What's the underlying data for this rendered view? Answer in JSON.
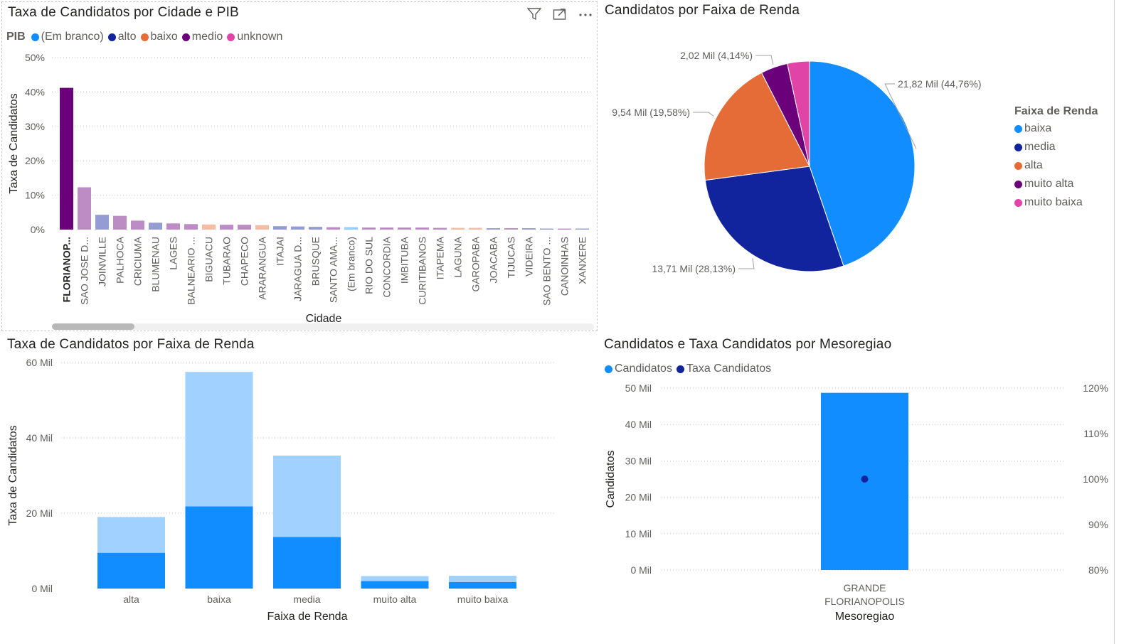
{
  "colors": {
    "blank": "#118dff",
    "alto": "#12239e",
    "baixo": "#e66c37",
    "medio": "#6b007b",
    "unknown": "#e044a7"
  },
  "visual1": {
    "title": "Taxa de Candidatos por Cidade e PIB",
    "icons": [
      "filter-icon",
      "focus-mode-icon",
      "more-options-icon"
    ]
  },
  "visual2": {
    "title": "Candidatos por Faixa de Renda"
  },
  "visual3": {
    "title": "Taxa de Candidatos por Faixa de Renda"
  },
  "visual4": {
    "title": "Candidatos e Taxa Candidatos por Mesoregiao"
  },
  "chart_data": [
    {
      "type": "bar",
      "title": "Taxa de Candidatos por Cidade e PIB",
      "xlabel": "Cidade",
      "ylabel": "Taxa de Candidatos",
      "ylim": [
        0,
        50
      ],
      "yticks": [
        "0%",
        "10%",
        "20%",
        "30%",
        "40%",
        "50%"
      ],
      "legend_title": "PIB",
      "legend": [
        {
          "name": "(Em branco)",
          "color": "#118dff"
        },
        {
          "name": "alto",
          "color": "#12239e"
        },
        {
          "name": "baixo",
          "color": "#e66c37"
        },
        {
          "name": "medio",
          "color": "#6b007b"
        },
        {
          "name": "unknown",
          "color": "#e044a7"
        }
      ],
      "legend_placement": "top-left",
      "grid": true,
      "categories": [
        "FLORIANOP...",
        "SAO JOSE D...",
        "JOINVILLE",
        "PALHOCA",
        "CRICIUMA",
        "BLUMENAU",
        "LAGES",
        "BALNEARIO ...",
        "BIGUACU",
        "TUBARAO",
        "CHAPECO",
        "ARARANGUA",
        "ITAJAI",
        "JARAGUA D...",
        "BRUSQUE",
        "SANTO AMA...",
        "(Em branco)",
        "RIO DO SUL",
        "CONCORDIA",
        "IMBITUBA",
        "CURITIBANOS",
        "ITAPEMA",
        "LAGUNA",
        "GAROPABA",
        "JOACABA",
        "TIJUCAS",
        "VIDEIRA",
        "SAO BENTO ...",
        "CANOINHAS",
        "XANXERE"
      ],
      "values": [
        41.2,
        12.3,
        4.3,
        4.0,
        2.6,
        2.0,
        1.8,
        1.6,
        1.5,
        1.4,
        1.4,
        1.3,
        1.0,
        0.9,
        0.8,
        0.7,
        0.7,
        0.6,
        0.6,
        0.6,
        0.6,
        0.5,
        0.5,
        0.5,
        0.4,
        0.4,
        0.4,
        0.3,
        0.3,
        0.3
      ],
      "series_of_bar": [
        "medio",
        "medio",
        "alto",
        "medio",
        "medio",
        "alto",
        "medio",
        "medio",
        "baixo",
        "medio",
        "medio",
        "baixo",
        "alto",
        "alto",
        "alto",
        "medio",
        "(Em branco)",
        "medio",
        "medio",
        "medio",
        "medio",
        "medio",
        "baixo",
        "baixo",
        "alto",
        "medio",
        "alto",
        "alto",
        "medio",
        "alto"
      ],
      "highlighted": 0
    },
    {
      "type": "pie",
      "title": "Candidatos por Faixa de Renda",
      "legend_title": "Faixa de Renda",
      "legend_placement": "right",
      "slices": [
        {
          "name": "baixa",
          "value": 21.82,
          "label": "21,82 Mil (44,76%)",
          "percent": 44.76,
          "color": "#118dff"
        },
        {
          "name": "media",
          "value": 13.71,
          "label": "13,71 Mil (28,13%)",
          "percent": 28.13,
          "color": "#12239e"
        },
        {
          "name": "alta",
          "value": 9.54,
          "label": "9,54 Mil (19,58%)",
          "percent": 19.58,
          "color": "#e66c37"
        },
        {
          "name": "muito alta",
          "value": 2.02,
          "label": "2,02 Mil (4,14%)",
          "percent": 4.14,
          "color": "#6b007b"
        },
        {
          "name": "muito baixa",
          "value": 1.7,
          "label": "",
          "percent": 3.39,
          "color": "#e044a7"
        }
      ]
    },
    {
      "type": "bar",
      "title": "Taxa de Candidatos por Faixa de Renda",
      "xlabel": "Faixa de Renda",
      "ylabel": "Taxa de Candidatos",
      "ylim": [
        0,
        60
      ],
      "yticks": [
        "0 Mil",
        "20 Mil",
        "40 Mil",
        "60 Mil"
      ],
      "grid": true,
      "categories": [
        "alta",
        "baixa",
        "media",
        "muito alta",
        "muito baixa"
      ],
      "series": [
        {
          "color": "#118dff",
          "values": [
            9.5,
            21.8,
            13.7,
            2.0,
            1.7
          ]
        },
        {
          "color": "#a0d1ff",
          "values": [
            9.5,
            35.7,
            21.6,
            1.3,
            1.7
          ]
        }
      ],
      "stacked": true
    },
    {
      "type": "bar",
      "title": "Candidatos e Taxa Candidatos por Mesoregiao",
      "xlabel": "Mesoregiao",
      "ylabel": "Candidatos",
      "ylim": [
        0,
        50
      ],
      "yticks": [
        "0 Mil",
        "10 Mil",
        "20 Mil",
        "30 Mil",
        "40 Mil",
        "50 Mil"
      ],
      "y2lim": [
        80,
        120
      ],
      "y2ticks": [
        "80%",
        "90%",
        "100%",
        "110%",
        "120%"
      ],
      "legend": [
        {
          "name": "Candidatos",
          "color": "#118dff"
        },
        {
          "name": "Taxa Candidatos",
          "color": "#12239e"
        }
      ],
      "legend_placement": "top-left",
      "categories": [
        "GRANDE FLORIANOPOLIS"
      ],
      "category_lines": [
        "GRANDE",
        "FLORIANOPOLIS"
      ],
      "bar_values": [
        48.7
      ],
      "line_values": [
        100
      ]
    }
  ]
}
